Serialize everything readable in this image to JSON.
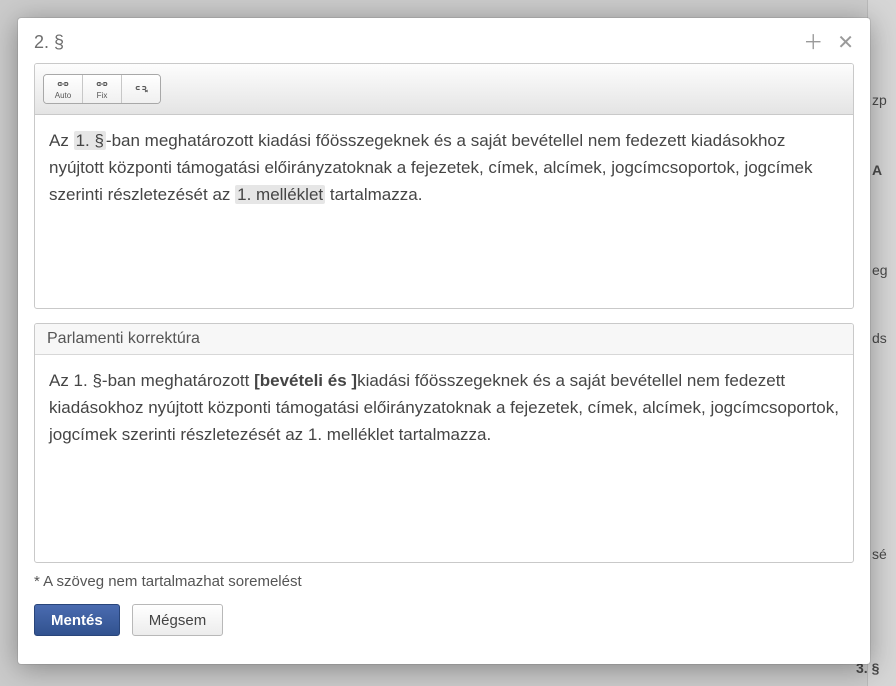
{
  "dialog": {
    "title": "2. §",
    "toolbar": {
      "btn_auto": "Auto",
      "btn_fix": "Fix",
      "btn_remove": ""
    },
    "editor": {
      "t1": "Az ",
      "hl1": "1. §",
      "t2": "-ban meghatározott kiadási főösszegeknek és a saját bevétellel nem fedezett kiadásokhoz nyújtott központi támogatási előirányzatoknak a fejezetek, címek, alcímek, jogcímcsoportok, jogcímek szerinti részletezését az ",
      "hl2": "1. melléklet",
      "t3": " tartalmazza."
    },
    "correction": {
      "header": "Parlamenti korrektúra",
      "t1": "Az 1. §-ban meghatározott ",
      "ins": "[bevételi és ]",
      "t2": "kiadási főösszegeknek és a saját bevétellel nem fedezett kiadásokhoz nyújtott központi támogatási előirányzatoknak a fejezetek, címek, alcímek, jogcímcsoportok, jogcímek szerinti részletezését az 1. melléklet tartalmazza."
    },
    "note": "* A szöveg nem tartalmazhat soremelést",
    "save": "Mentés",
    "cancel": "Mégsem"
  },
  "bg": {
    "f1": "zp",
    "f2": "A",
    "f3": "eg",
    "f4": "ds",
    "f5": "sé",
    "f6": "3. §"
  }
}
